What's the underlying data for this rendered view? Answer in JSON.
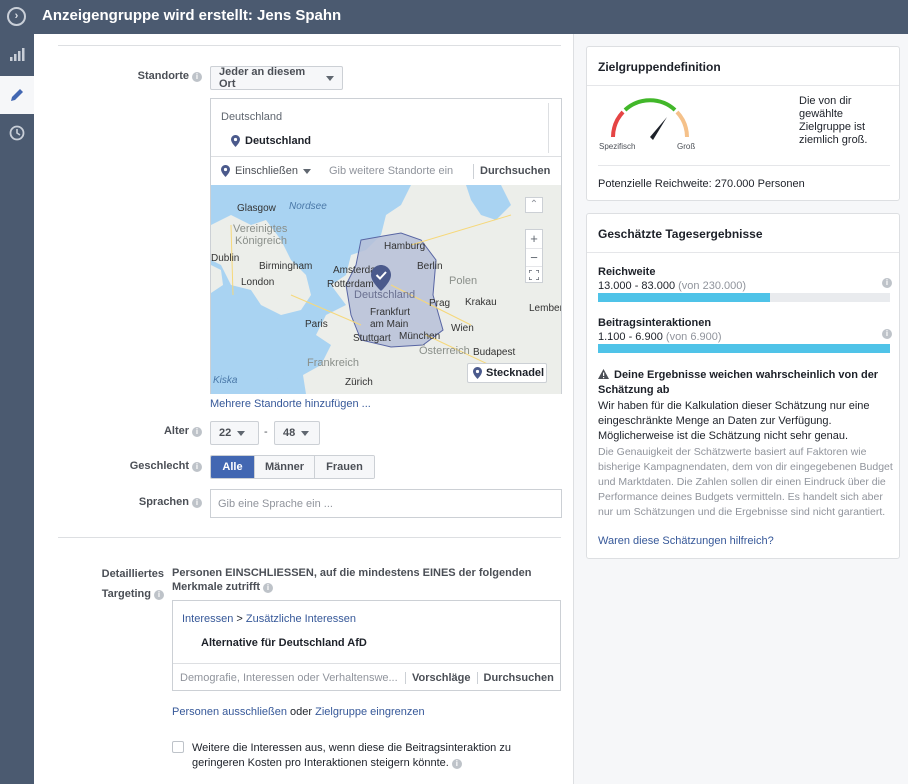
{
  "header": {
    "title": "Anzeigengruppe wird erstellt: Jens Spahn"
  },
  "nav": {
    "icons": [
      "chart-icon",
      "pencil-icon",
      "clock-icon"
    ]
  },
  "locations": {
    "label": "Standorte",
    "scope": "Jeder an diesem Ort",
    "group_heading": "Deutschland",
    "selected": "Deutschland",
    "mode": "Einschließen",
    "placeholder": "Gib weitere Standorte ein",
    "browse": "Durchsuchen",
    "pin_button": "Stecknadel",
    "add_multiple": "Mehrere Standorte hinzufügen ...",
    "map_labels": {
      "glasgow": "Glasgow",
      "nordsee": "Nordsee",
      "vk": "Vereinigtes",
      "kr": "Königreich",
      "dublin": "Dublin",
      "birmingham": "Birmingham",
      "london": "London",
      "hamburg": "Hamburg",
      "amsterdam": "Amsterdam",
      "berlin": "Berlin",
      "rotterdam": "Rotterdam",
      "deutschland": "Deutschland",
      "polen": "Polen",
      "paris": "Paris",
      "frankfurt": "Frankfurt",
      "ammain": "am Main",
      "prag": "Prag",
      "krakau": "Krakau",
      "stuttgart": "Stuttgart",
      "muenchen": "München",
      "wien": "Wien",
      "oesterreich": "Österreich",
      "frankreich": "Frankreich",
      "zuerich": "Zürich",
      "lemberg": "Lember",
      "budapest": "Budapest",
      "kiska": "Kiska"
    }
  },
  "age": {
    "label": "Alter",
    "from": "22",
    "separator": "-",
    "to": "48"
  },
  "gender": {
    "label": "Geschlecht",
    "options": [
      "Alle",
      "Männer",
      "Frauen"
    ]
  },
  "languages": {
    "label": "Sprachen",
    "placeholder": "Gib eine Sprache ein ..."
  },
  "targeting": {
    "label_line1": "Detailliertes",
    "label_line2": "Targeting",
    "description": "Personen EINSCHLIESSEN, auf die mindestens EINES der folgenden Merkmale zutrifft",
    "crumb_root": "Interessen",
    "crumb_sep": " > ",
    "crumb_leaf": "Zusätzliche Interessen",
    "item": "Alternative für Deutschland AfD",
    "placeholder": "Demografie, Interessen oder Verhaltenswe...",
    "suggestions": "Vorschläge",
    "browse": "Durchsuchen",
    "exclude_link": "Personen ausschließen",
    "or": " oder ",
    "narrow_link": "Zielgruppe eingrenzen",
    "expand_text": "Weitere die Interessen aus, wenn diese die Beitragsinteraktion zu geringeren Kosten pro Interaktionen steigern könnte."
  },
  "audience": {
    "title": "Zielgruppendefinition",
    "specific": "Spezifisch",
    "broad": "Groß",
    "description": "Die von dir gewählte Zielgruppe ist ziemlich groß.",
    "reach": "Potenzielle Reichweite: 270.000 Personen"
  },
  "daily": {
    "title": "Geschätzte Tagesergebnisse",
    "reach_label": "Reichweite",
    "reach_value": "13.000 - 83.000",
    "reach_of": "(von 230.000)",
    "reach_fraction": 0.59,
    "engagement_label": "Beitragsinteraktionen",
    "engagement_value": "1.100 - 6.900",
    "engagement_of": "(von 6.900)",
    "engagement_fraction": 1.0,
    "warning_title": "Deine Ergebnisse weichen wahrscheinlich von der Schätzung ab",
    "warning_text": "Wir haben für die Kalkulation dieser Schätzung nur eine eingeschränkte Menge an Daten zur Verfügung. Möglicherweise ist die Schätzung nicht sehr genau.",
    "note": "Die Genauigkeit der Schätzwerte basiert auf Faktoren wie bisherige Kampagnendaten, dem von dir eingegebenen Budget und Marktdaten. Die Zahlen sollen dir einen Eindruck über die Performance deines Budgets vermitteln. Es handelt sich aber nur um Schätzungen und die Ergebnisse sind nicht garantiert.",
    "feedback": "Waren diese Schätzungen hilfreich?"
  },
  "colors": {
    "accent": "#4267b2",
    "header": "#4b5a70",
    "bar": "#4fc3e8"
  }
}
